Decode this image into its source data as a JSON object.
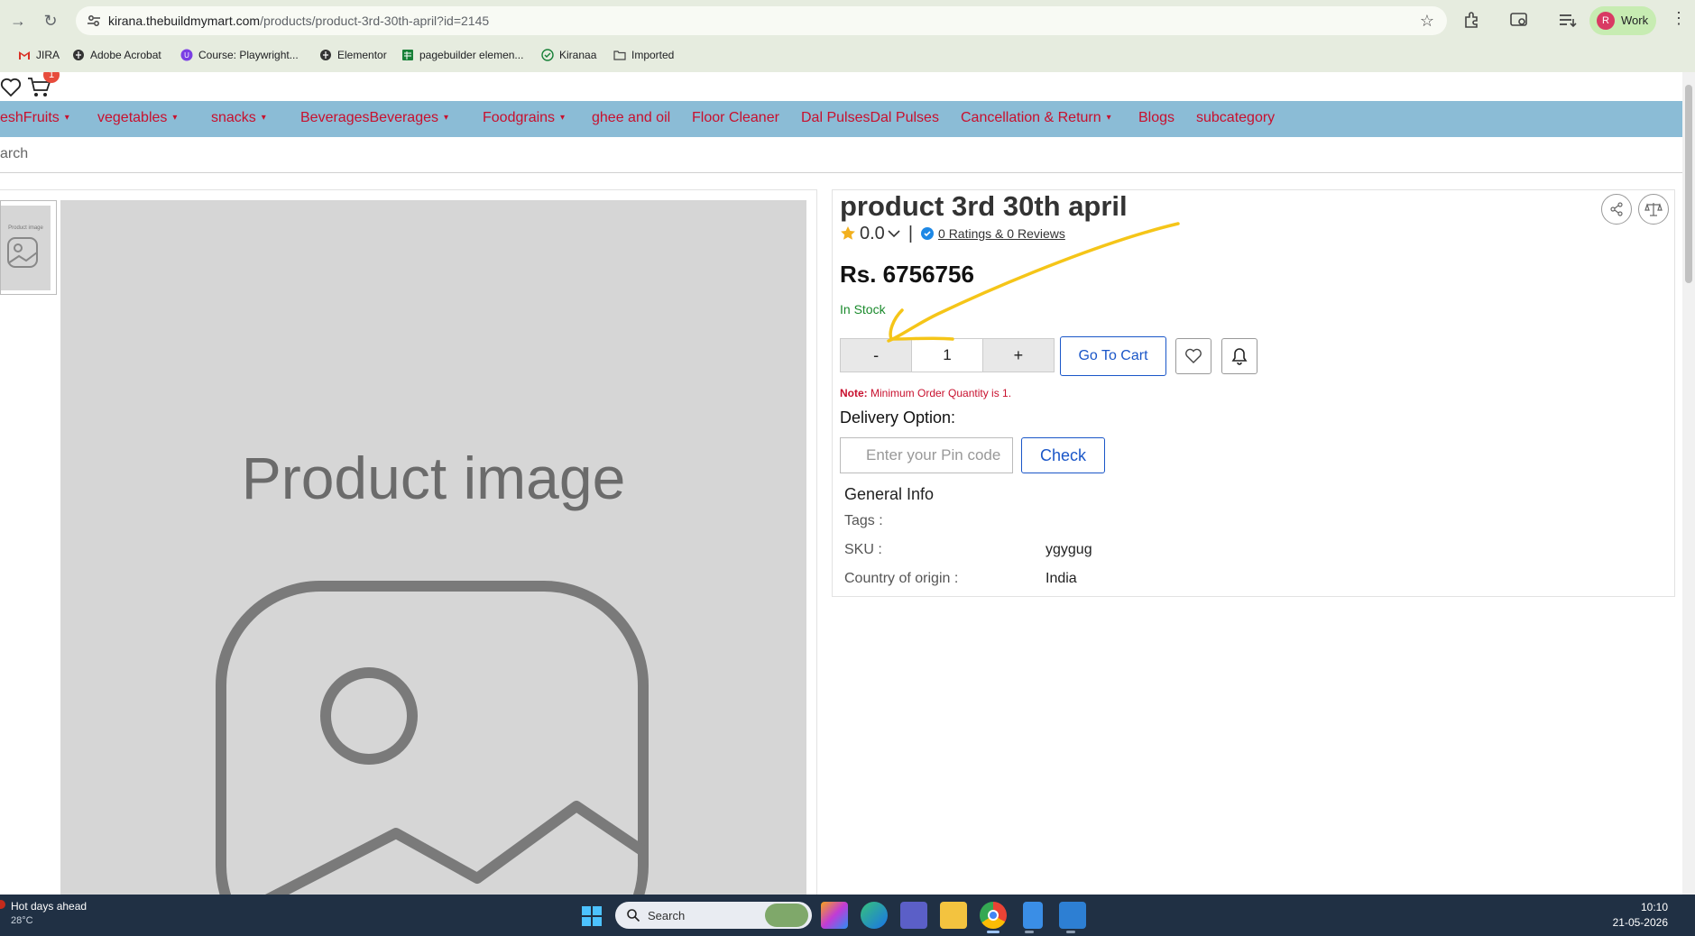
{
  "browser": {
    "url_host": "kirana.thebuildmymart.com",
    "url_path": "/products/product-3rd-30th-april?id=2145",
    "profile_initial": "R",
    "profile_label": "Work",
    "bookmarks": [
      {
        "label": "JIRA",
        "icon": "gmail-icon"
      },
      {
        "label": "Adobe Acrobat",
        "icon": "globe-icon"
      },
      {
        "label": "Course: Playwright...",
        "icon": "course-icon"
      },
      {
        "label": "Elementor",
        "icon": "globe-icon"
      },
      {
        "label": "pagebuilder elemen...",
        "icon": "sheets-icon"
      },
      {
        "label": "Kiranaa",
        "icon": "check-icon"
      },
      {
        "label": "Imported",
        "icon": "folder-icon"
      }
    ]
  },
  "header": {
    "cart_badge": "1"
  },
  "nav": {
    "items": [
      {
        "label": "eshFruits",
        "dropdown": true
      },
      {
        "label": "vegetables",
        "dropdown": true
      },
      {
        "label": "snacks",
        "dropdown": true
      },
      {
        "label": "BeveragesBeverages",
        "dropdown": true
      },
      {
        "label": "Foodgrains",
        "dropdown": true
      },
      {
        "label": "ghee and oil",
        "dropdown": false
      },
      {
        "label": "Floor Cleaner",
        "dropdown": false
      },
      {
        "label": "Dal PulsesDal Pulses",
        "dropdown": false
      },
      {
        "label": "Cancellation & Return",
        "dropdown": true
      },
      {
        "label": "Blogs",
        "dropdown": false
      },
      {
        "label": "subcategory",
        "dropdown": false
      }
    ],
    "caret": "▾"
  },
  "search": {
    "placeholder": "arch"
  },
  "gallery": {
    "thumb_label": "Product image",
    "main_label": "Product image"
  },
  "product": {
    "title": "product 3rd 30th april",
    "rating": "0.0",
    "ratings_text": "0 Ratings  & 0 Reviews",
    "price": "Rs. 6756756",
    "stock": "In Stock",
    "qty_minus": "-",
    "qty_value": "1",
    "qty_plus": "+",
    "go_to_cart": "Go To Cart",
    "note_label": "Note:",
    "note_text": " Minimum Order Quantity is 1.",
    "delivery_label": "Delivery Option:",
    "pin_placeholder": "Enter your Pin code",
    "check_label": "Check",
    "general_info_title": "General Info",
    "info": [
      {
        "label": "Tags :",
        "value": ""
      },
      {
        "label": "SKU :",
        "value": "ygygug"
      },
      {
        "label": "Country of origin :",
        "value": "India"
      }
    ]
  },
  "colors": {
    "nav_bg": "#8bbcd6",
    "nav_text": "#c8102e",
    "accent_blue": "#1a56c8",
    "stock_green": "#1a8a2c",
    "annotation_yellow": "#f5c518"
  },
  "taskbar": {
    "weather_title": "Hot days ahead",
    "weather_temp": "28°C",
    "search_label": "Search",
    "time": "10:10",
    "date": "21-05-2026"
  }
}
